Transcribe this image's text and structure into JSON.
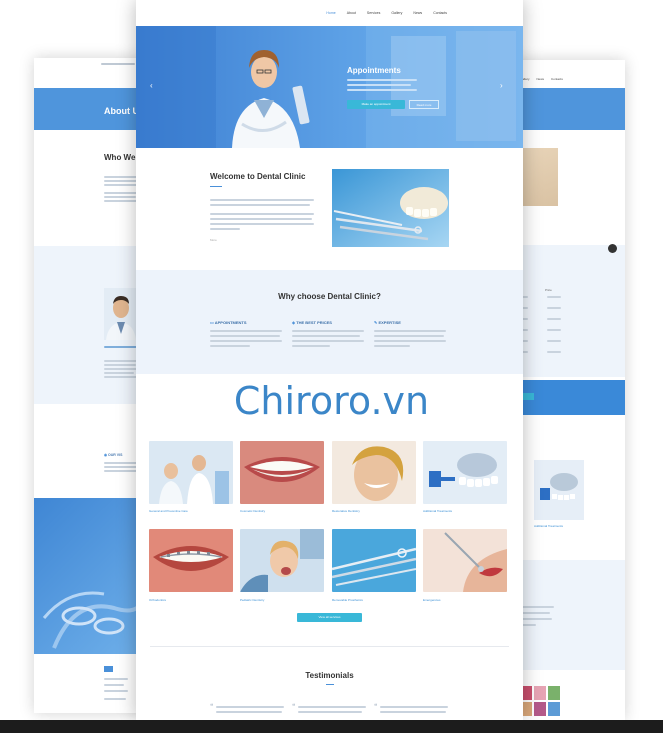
{
  "watermark": "Chiroro.vn",
  "main_page": {
    "nav": [
      "Home",
      "About",
      "Services",
      "Gallery",
      "News",
      "Contacts"
    ],
    "hero": {
      "title": "Appointments",
      "button_primary": "Make an appointment",
      "button_secondary": "Read more",
      "prev_icon": "chevron-left-icon",
      "next_icon": "chevron-right-icon"
    },
    "welcome": {
      "title": "Welcome to Dental Clinic",
      "more_label": "More"
    },
    "why": {
      "title": "Why choose Dental Clinic?",
      "features": [
        {
          "icon": "chat-icon",
          "title": "APPOINTMENTS"
        },
        {
          "icon": "tag-icon",
          "title": "THE BEST PRICES"
        },
        {
          "icon": "wrench-icon",
          "title": "EXPERTISE"
        }
      ]
    },
    "services": [
      "General and Preventive Care",
      "Cosmetic Dentistry",
      "Restorative Dentistry",
      "Additional Treatments",
      "Orthodontics",
      "Pediatric Dentistry",
      "Removable Prosthetics",
      "Emergencies"
    ],
    "view_all_label": "View all services",
    "testimonials_title": "Testimonials"
  },
  "left_page": {
    "about_title": "About Us",
    "who_title": "Who We",
    "our_title": "OUR VIS"
  },
  "right_page": {
    "nav": [
      "Gallery",
      "News",
      "Contacts"
    ],
    "table_header": "Price",
    "additional_caption": "Additional Treatments"
  },
  "colors": {
    "accent": "#4a90d9",
    "button": "#39b8d8",
    "watermark": "#3b86c8",
    "light_section": "#eef4fb"
  }
}
